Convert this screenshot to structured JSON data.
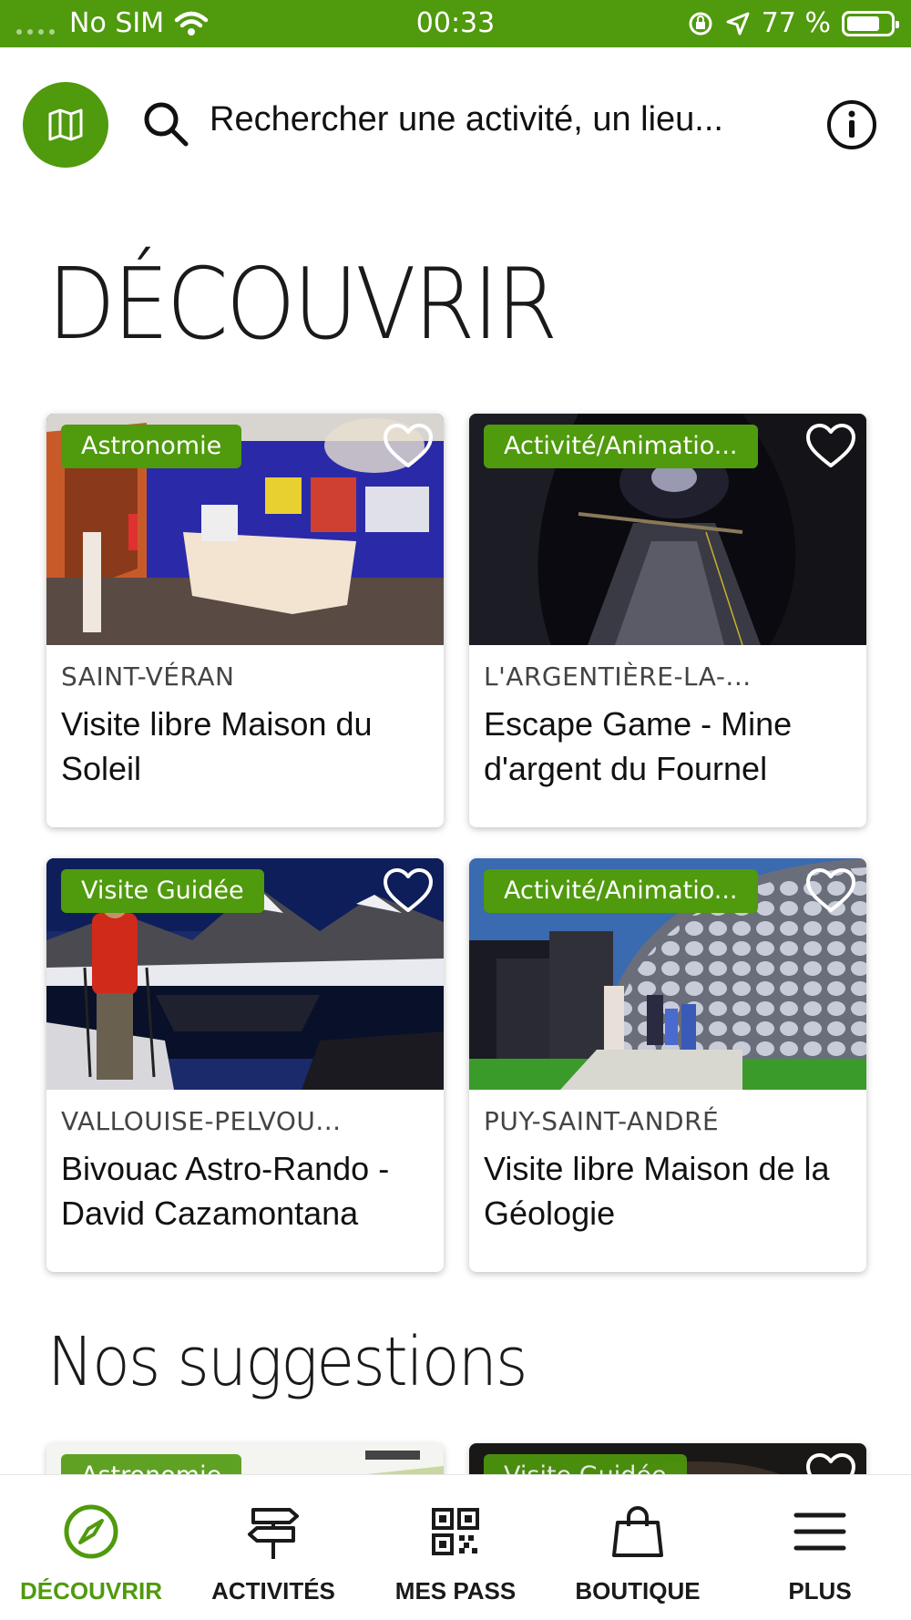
{
  "status_bar": {
    "carrier": "No SIM",
    "time": "00:33",
    "battery": "77 %",
    "battery_level": 0.77
  },
  "search": {
    "placeholder": "Rechercher une activité, un lieu..."
  },
  "page_title": "DÉCOUVRIR",
  "cards": [
    {
      "tag": "Astronomie",
      "location": "SAINT-VÉRAN",
      "title": "Visite libre Maison du Soleil"
    },
    {
      "tag": "Activité/Animatio...",
      "location": "L'ARGENTIÈRE-LA-...",
      "title": "Escape Game - Mine d'argent du Fournel"
    },
    {
      "tag": "Visite Guidée",
      "location": "VALLOUISE-PELVOU...",
      "title": "Bivouac Astro-Rando - David Cazamontana"
    },
    {
      "tag": "Activité/Animatio...",
      "location": "PUY-SAINT-ANDRÉ",
      "title": "Visite libre Maison de la Géologie"
    }
  ],
  "suggestions": {
    "title": "Nos suggestions",
    "cards": [
      {
        "tag": "Astronomie"
      },
      {
        "tag": "Visite Guidée"
      }
    ]
  },
  "tabs": [
    {
      "label": "DÉCOUVRIR",
      "icon": "compass-icon",
      "active": true
    },
    {
      "label": "ACTIVITÉS",
      "icon": "signpost-icon",
      "active": false
    },
    {
      "label": "MES PASS",
      "icon": "qr-code-icon",
      "active": false
    },
    {
      "label": "BOUTIQUE",
      "icon": "shopping-bag-icon",
      "active": false
    },
    {
      "label": "PLUS",
      "icon": "menu-icon",
      "active": false
    }
  ],
  "colors": {
    "brand_green": "#4f9a0d"
  }
}
